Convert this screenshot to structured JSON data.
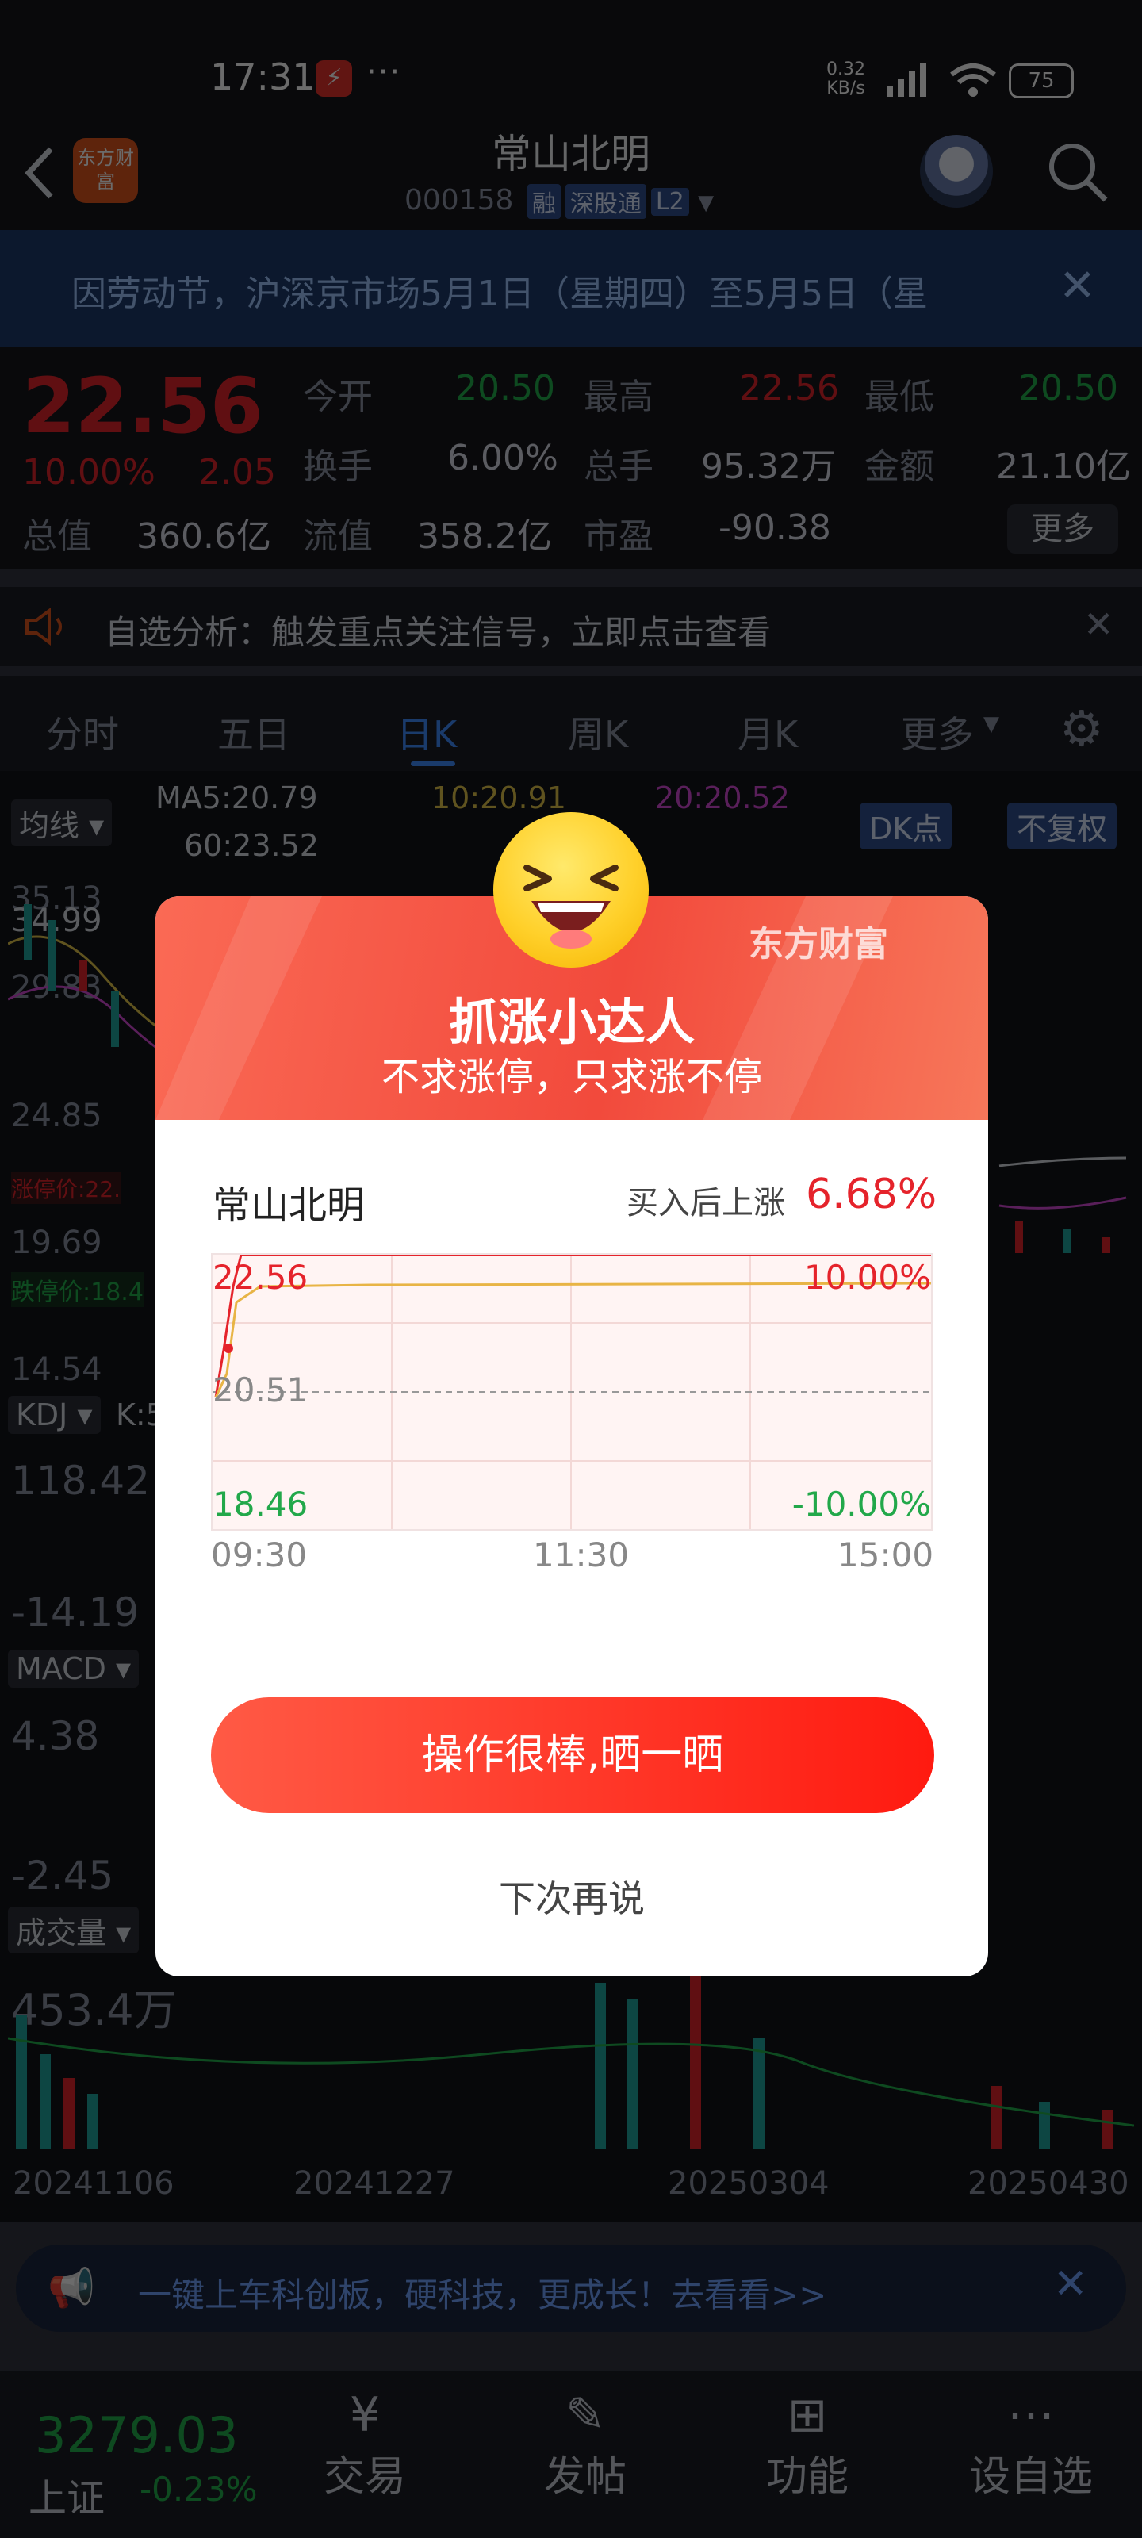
{
  "status_bar": {
    "time": "17:31",
    "dots": "···",
    "speed_top": "0.32",
    "speed_bottom": "KB/s",
    "network": "HD",
    "battery": "75"
  },
  "header": {
    "logo_text": "东方财富",
    "title": "常山北明",
    "code": "000158",
    "tags": [
      "融",
      "深股通",
      "L2"
    ]
  },
  "notice": {
    "text": "因劳动节，沪深京市场5月1日（星期四）至5月5日（星"
  },
  "quote": {
    "price": "22.56",
    "change_pct": "10.00%",
    "change_amt": "2.05",
    "rows": [
      [
        {
          "label": "今开",
          "value": "20.50",
          "color": "#22b14c"
        },
        {
          "label": "最高",
          "value": "22.56",
          "color": "#e5232b"
        },
        {
          "label": "最低",
          "value": "20.50",
          "color": "#22b14c"
        }
      ],
      [
        {
          "label": "换手",
          "value": "6.00%",
          "color": "#d8dce6"
        },
        {
          "label": "总手",
          "value": "95.32万",
          "color": "#d8dce6"
        },
        {
          "label": "金额",
          "value": "21.10亿",
          "color": "#d8dce6"
        }
      ],
      [
        {
          "label": "总值",
          "value": "360.6亿",
          "color": "#d8dce6"
        },
        {
          "label": "流值",
          "value": "358.2亿",
          "color": "#d8dce6"
        },
        {
          "label": "市盈",
          "value": "-90.38",
          "color": "#d8dce6"
        }
      ]
    ],
    "more": "更多"
  },
  "analysis": {
    "text": "自选分析：触发重点关注信号，立即点击查看"
  },
  "tabs": [
    "分时",
    "五日",
    "日K",
    "周K",
    "月K",
    "更多"
  ],
  "chart": {
    "ma_selector": "均线",
    "ma5": "MA5:20.79",
    "ma10": "10:20.91",
    "ma20": "20:20.52",
    "ma60": "60:23.52",
    "dk": "DK点",
    "fq": "不复权",
    "price_ticks": [
      "35.13",
      "34.99",
      "29.83",
      "24.85",
      "19.69",
      "14.54"
    ],
    "limit_up": "涨停价:22.",
    "limit_down": "跌停价:18.4",
    "kdj": "KDJ",
    "kdj_k": "K:5",
    "kdj_ticks": [
      "118.42",
      "-14.19"
    ],
    "macd": "MACD",
    "macd_ticks": [
      "4.38",
      "-2.45"
    ],
    "vol": "成交量",
    "vol_tick": "453.4万",
    "dates": [
      "20241106",
      "20241227",
      "20250304",
      "20250430"
    ]
  },
  "ad": {
    "text": "一键上车科创板，硬科技，更成长！去看看>>"
  },
  "bottom_nav": {
    "index_value": "3279.03",
    "index_name": "上证",
    "index_change": "-0.23%",
    "items": [
      "交易",
      "发帖",
      "功能",
      "设自选"
    ]
  },
  "dialog": {
    "brand": "东方财富",
    "title": "抓涨小达人",
    "subtitle": "不求涨停，只求涨不停",
    "stock": "常山北明",
    "gain_label": "买入后上涨",
    "gain": "6.68%",
    "chart_high": "22.56",
    "chart_mid": "20.51",
    "chart_low": "18.46",
    "pct_high": "10.00%",
    "pct_low": "-10.00%",
    "time_start": "09:30",
    "time_mid": "11:30",
    "time_end": "15:00",
    "share_button": "操作很棒,晒一晒",
    "skip": "下次再说"
  },
  "colors": {
    "up": "#e5232b",
    "down": "#22b14c",
    "accent": "#3f8cff"
  }
}
